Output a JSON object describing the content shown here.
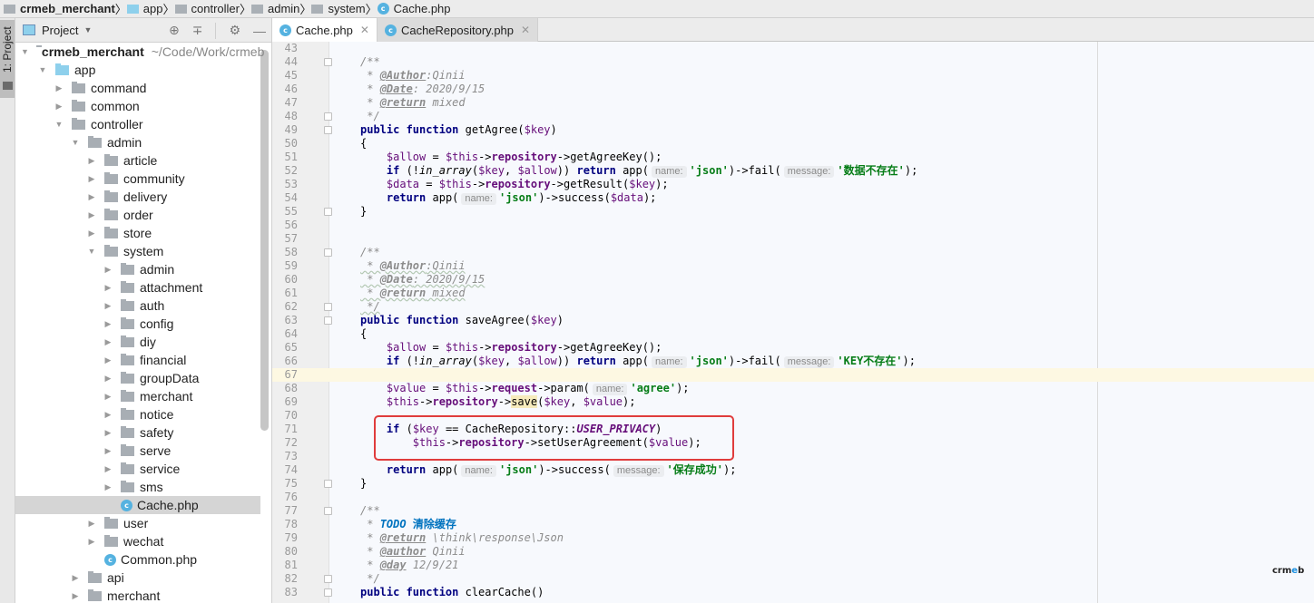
{
  "breadcrumb": [
    {
      "label": "crmeb_merchant",
      "icon": "folder-icon",
      "bold": true
    },
    {
      "label": "app",
      "icon": "folder-blue-icon"
    },
    {
      "label": "controller",
      "icon": "folder-icon"
    },
    {
      "label": "admin",
      "icon": "folder-icon"
    },
    {
      "label": "system",
      "icon": "folder-icon"
    },
    {
      "label": "Cache.php",
      "icon": "php-class-icon"
    }
  ],
  "sidebar_strip": {
    "label": "1: Project"
  },
  "project_panel": {
    "title": "Project",
    "tools": [
      "locate-icon",
      "collapse-all-icon",
      "gear-icon",
      "minimize-icon"
    ],
    "tree": [
      {
        "label": "crmeb_merchant",
        "path": "~/Code/Work/crmeb",
        "depth": 0,
        "expanded": true,
        "type": "folder",
        "bold": true
      },
      {
        "label": "app",
        "depth": 1,
        "expanded": true,
        "type": "folder-blue"
      },
      {
        "label": "command",
        "depth": 2,
        "expanded": false,
        "type": "folder"
      },
      {
        "label": "common",
        "depth": 2,
        "expanded": false,
        "type": "folder"
      },
      {
        "label": "controller",
        "depth": 2,
        "expanded": true,
        "type": "folder"
      },
      {
        "label": "admin",
        "depth": 3,
        "expanded": true,
        "type": "folder"
      },
      {
        "label": "article",
        "depth": 4,
        "expanded": false,
        "type": "folder"
      },
      {
        "label": "community",
        "depth": 4,
        "expanded": false,
        "type": "folder"
      },
      {
        "label": "delivery",
        "depth": 4,
        "expanded": false,
        "type": "folder"
      },
      {
        "label": "order",
        "depth": 4,
        "expanded": false,
        "type": "folder"
      },
      {
        "label": "store",
        "depth": 4,
        "expanded": false,
        "type": "folder"
      },
      {
        "label": "system",
        "depth": 4,
        "expanded": true,
        "type": "folder"
      },
      {
        "label": "admin",
        "depth": 5,
        "expanded": false,
        "type": "folder"
      },
      {
        "label": "attachment",
        "depth": 5,
        "expanded": false,
        "type": "folder"
      },
      {
        "label": "auth",
        "depth": 5,
        "expanded": false,
        "type": "folder"
      },
      {
        "label": "config",
        "depth": 5,
        "expanded": false,
        "type": "folder"
      },
      {
        "label": "diy",
        "depth": 5,
        "expanded": false,
        "type": "folder"
      },
      {
        "label": "financial",
        "depth": 5,
        "expanded": false,
        "type": "folder"
      },
      {
        "label": "groupData",
        "depth": 5,
        "expanded": false,
        "type": "folder"
      },
      {
        "label": "merchant",
        "depth": 5,
        "expanded": false,
        "type": "folder"
      },
      {
        "label": "notice",
        "depth": 5,
        "expanded": false,
        "type": "folder"
      },
      {
        "label": "safety",
        "depth": 5,
        "expanded": false,
        "type": "folder"
      },
      {
        "label": "serve",
        "depth": 5,
        "expanded": false,
        "type": "folder"
      },
      {
        "label": "service",
        "depth": 5,
        "expanded": false,
        "type": "folder"
      },
      {
        "label": "sms",
        "depth": 5,
        "expanded": false,
        "type": "folder"
      },
      {
        "label": "Cache.php",
        "depth": 5,
        "type": "php",
        "selected": true
      },
      {
        "label": "user",
        "depth": 4,
        "expanded": false,
        "type": "folder"
      },
      {
        "label": "wechat",
        "depth": 4,
        "expanded": false,
        "type": "folder"
      },
      {
        "label": "Common.php",
        "depth": 4,
        "type": "php"
      },
      {
        "label": "api",
        "depth": 3,
        "expanded": false,
        "type": "folder"
      },
      {
        "label": "merchant",
        "depth": 3,
        "expanded": false,
        "type": "folder"
      }
    ]
  },
  "tabs": [
    {
      "label": "Cache.php",
      "active": true
    },
    {
      "label": "CacheRepository.php",
      "active": false
    }
  ],
  "editor": {
    "current_line": 67,
    "highlighted_lines": [
      71,
      72
    ],
    "lines": [
      {
        "n": 43,
        "html": ""
      },
      {
        "n": 44,
        "fold": true,
        "html": "<span class='cmt'>/**</span>"
      },
      {
        "n": 45,
        "html": "<span class='cmt'> * <span class='tag'>@Author</span>:Qinii</span>"
      },
      {
        "n": 46,
        "html": "<span class='cmt'> * <span class='tag'>@Date</span>: 2020/9/15</span>"
      },
      {
        "n": 47,
        "html": "<span class='cmt'> * <span class='tag'>@return</span> mixed</span>"
      },
      {
        "n": 48,
        "fold": true,
        "html": "<span class='cmt'> */</span>"
      },
      {
        "n": 49,
        "fold": true,
        "html": "<span class='kw'>public function</span> getAgree(<span class='v'>$key</span>)"
      },
      {
        "n": 50,
        "html": "{"
      },
      {
        "n": 51,
        "html": "    <span class='v'>$allow</span> = <span class='v'>$this</span>-><span class='prop'>repository</span>->getAgreeKey();"
      },
      {
        "n": 52,
        "html": "    <span class='kw'>if</span> (!<span class='fn-italic'>in_array</span>(<span class='v'>$key</span>, <span class='v'>$allow</span>)) <span class='kw'>return</span> app(<span class='hint'>name:</span><span class='str'>'json'</span>)->fail(<span class='hint'>message:</span><span class='str'>'数据不存在'</span>);"
      },
      {
        "n": 53,
        "html": "    <span class='v'>$data</span> = <span class='v'>$this</span>-><span class='prop'>repository</span>->getResult(<span class='v'>$key</span>);"
      },
      {
        "n": 54,
        "html": "    <span class='kw'>return</span> app(<span class='hint'>name:</span><span class='str'>'json'</span>)->success(<span class='v'>$data</span>);"
      },
      {
        "n": 55,
        "fold": true,
        "html": "}"
      },
      {
        "n": 56,
        "html": ""
      },
      {
        "n": 57,
        "html": ""
      },
      {
        "n": 58,
        "fold": true,
        "html": "<span class='cmt'>/**</span>"
      },
      {
        "n": 59,
        "html": "<span class='cmt squig'> * <b>@Author</b>:Qinii</span>"
      },
      {
        "n": 60,
        "html": "<span class='cmt squig'> * <b>@Date</b>: 2020/9/15</span>"
      },
      {
        "n": 61,
        "html": "<span class='cmt squig'> * <b>@return</b> mixed</span>"
      },
      {
        "n": 62,
        "fold": true,
        "html": "<span class='cmt squig'> */</span>"
      },
      {
        "n": 63,
        "fold": true,
        "html": "<span class='kw'>public function</span> saveAgree(<span class='v'>$key</span>)"
      },
      {
        "n": 64,
        "html": "{"
      },
      {
        "n": 65,
        "html": "    <span class='v'>$allow</span> = <span class='v'>$this</span>-><span class='prop'>repository</span>->getAgreeKey();"
      },
      {
        "n": 66,
        "html": "    <span class='kw'>if</span> (!<span class='fn-italic'>in_array</span>(<span class='v'>$key</span>, <span class='v'>$allow</span>)) <span class='kw'>return</span> app(<span class='hint'>name:</span><span class='str'>'json'</span>)->fail(<span class='hint'>message:</span><span class='str'>'KEY不存在'</span>);"
      },
      {
        "n": 67,
        "html": ""
      },
      {
        "n": 68,
        "html": "    <span class='v'>$value</span> = <span class='v'>$this</span>-><span class='prop'>request</span>->param(<span class='hint'>name:</span><span class='str'>'agree'</span>);"
      },
      {
        "n": 69,
        "html": "    <span class='v'>$this</span>-><span class='prop'>repository</span>-><span class='save-hl'>save</span>(<span class='v'>$key</span>, <span class='v'>$value</span>);"
      },
      {
        "n": 70,
        "html": ""
      },
      {
        "n": 71,
        "html": "    <span class='kw'>if</span> (<span class='v'>$key</span> == CacheRepository::<span class='const'>USER_PRIVACY</span>)"
      },
      {
        "n": 72,
        "html": "        <span class='v'>$this</span>-><span class='prop'>repository</span>->setUserAgreement(<span class='v'>$value</span>);"
      },
      {
        "n": 73,
        "html": ""
      },
      {
        "n": 74,
        "html": "    <span class='kw'>return</span> app(<span class='hint'>name:</span><span class='str'>'json'</span>)->success(<span class='hint'>message:</span><span class='str'>'保存成功'</span>);"
      },
      {
        "n": 75,
        "fold": true,
        "html": "}"
      },
      {
        "n": 76,
        "html": ""
      },
      {
        "n": 77,
        "fold": true,
        "html": "<span class='cmt'>/**</span>"
      },
      {
        "n": 78,
        "html": "<span class='cmt'> * <span class='todo'>TODO <span class='todo-cn'>清除缓存</span></span></span>"
      },
      {
        "n": 79,
        "html": "<span class='cmt'> * <span class='tag'>@return</span> \\think\\response\\Json</span>"
      },
      {
        "n": 80,
        "html": "<span class='cmt'> * <span class='tag'>@author</span> Qinii</span>"
      },
      {
        "n": 81,
        "html": "<span class='cmt'> * <span class='tag'>@day</span> 12/9/21</span>"
      },
      {
        "n": 82,
        "fold": true,
        "html": "<span class='cmt'> */</span>"
      },
      {
        "n": 83,
        "fold": true,
        "html": "<span class='kw'>public function</span> clearCache()"
      }
    ]
  },
  "brand": {
    "prefix": "crm",
    "accent": "e",
    "suffix": "b"
  },
  "colors": {
    "highlight_box": "#e03c3c",
    "keyword": "#000080",
    "string": "#067d17",
    "variable": "#660e7a",
    "current_line": "#fdf8e2"
  }
}
